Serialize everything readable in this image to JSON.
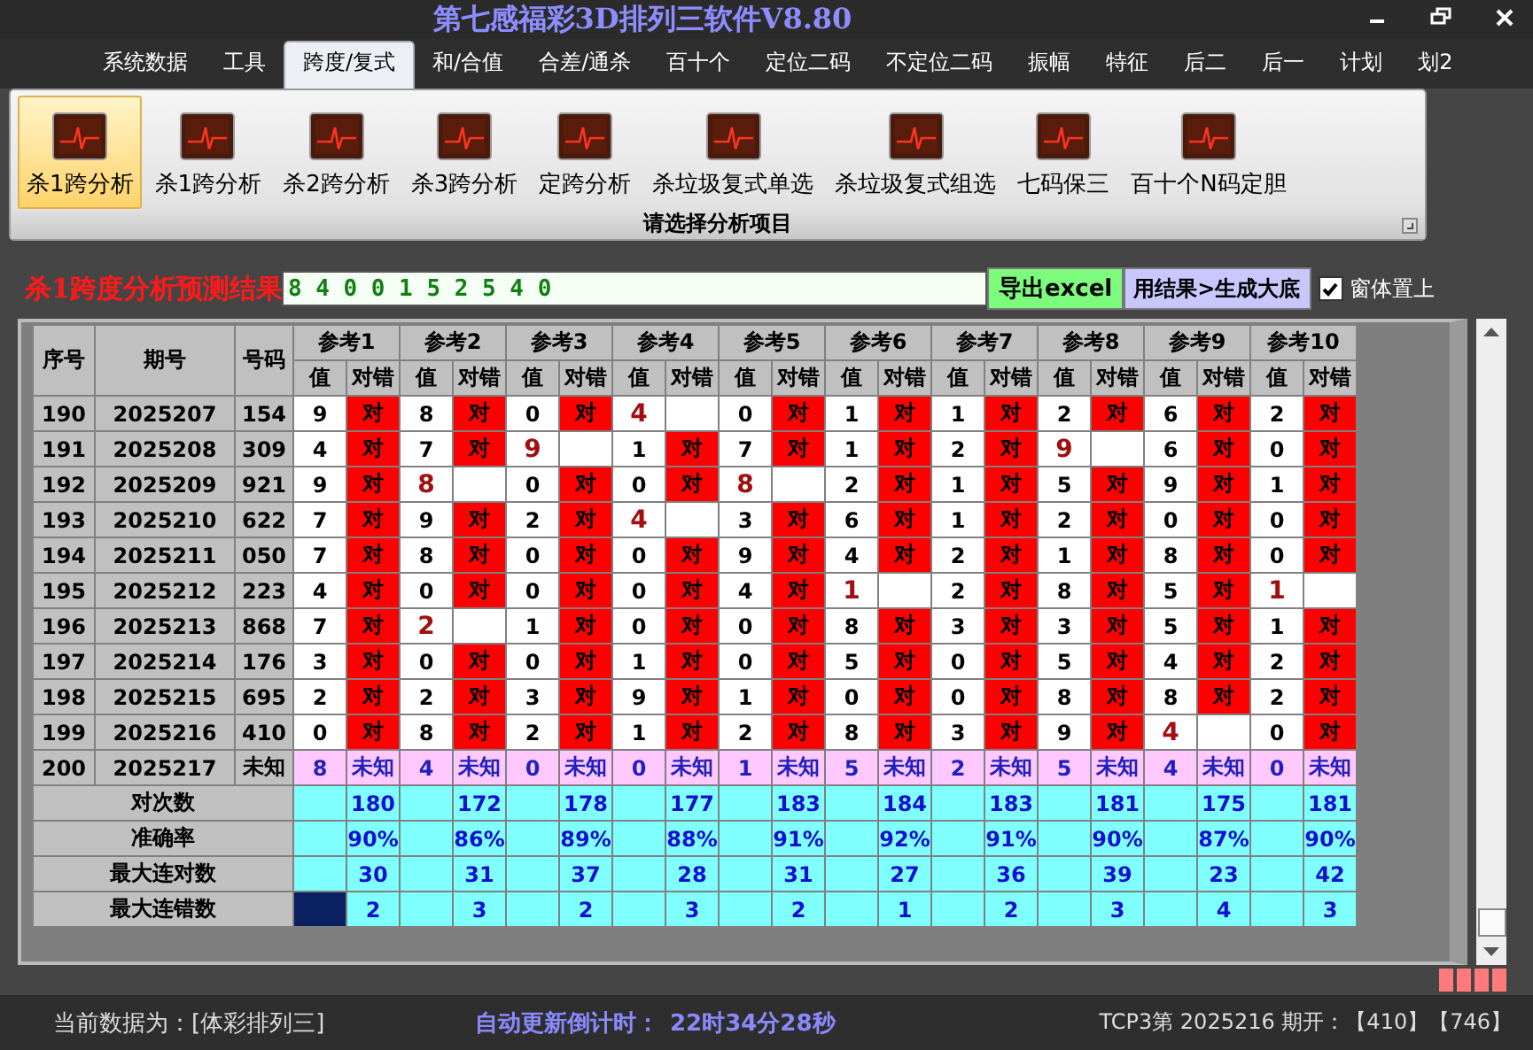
{
  "window": {
    "title": "第七感福彩3D排列三软件V8.80"
  },
  "menu": [
    {
      "label": "系统数据",
      "selected": false
    },
    {
      "label": "工具",
      "selected": false
    },
    {
      "label": "跨度/复式",
      "selected": true
    },
    {
      "label": "和/合值",
      "selected": false
    },
    {
      "label": "合差/通杀",
      "selected": false
    },
    {
      "label": "百十个",
      "selected": false
    },
    {
      "label": "定位二码",
      "selected": false
    },
    {
      "label": "不定位二码",
      "selected": false
    },
    {
      "label": "振幅",
      "selected": false
    },
    {
      "label": "特征",
      "selected": false
    },
    {
      "label": "后二",
      "selected": false
    },
    {
      "label": "后一",
      "selected": false
    },
    {
      "label": "计划",
      "selected": false
    },
    {
      "label": "划2",
      "selected": false
    }
  ],
  "ribbon": {
    "items": [
      {
        "label": "杀1跨分析",
        "selected": true
      },
      {
        "label": "杀1跨分析",
        "selected": false
      },
      {
        "label": "杀2跨分析",
        "selected": false
      },
      {
        "label": "杀3跨分析",
        "selected": false
      },
      {
        "label": "定跨分析",
        "selected": false
      },
      {
        "label": "杀垃圾复式单选",
        "selected": false
      },
      {
        "label": "杀垃圾复式组选",
        "selected": false
      },
      {
        "label": "七码保三",
        "selected": false
      },
      {
        "label": "百十个N码定胆",
        "selected": false
      }
    ],
    "group_label": "请选择分析项目"
  },
  "result": {
    "label": "杀1跨度分析预测结果",
    "value": "8 4 0 0 1 5 2 5 4 0",
    "export_button": "导出excel",
    "generate_button": "用结果>生成大底",
    "topmost": {
      "label": "窗体置上",
      "checked": true
    }
  },
  "table": {
    "columns": [
      "序号",
      "期号",
      "号码"
    ],
    "refs": [
      {
        "label": "参考1",
        "sub_columns": [
          "值",
          "对错"
        ]
      },
      {
        "label": "参考2",
        "sub_columns": [
          "值",
          "对错"
        ]
      },
      {
        "label": "参考3",
        "sub_columns": [
          "值",
          "对错"
        ]
      },
      {
        "label": "参考4",
        "sub_columns": [
          "值",
          "对错"
        ]
      },
      {
        "label": "参考5",
        "sub_columns": [
          "值",
          "对错"
        ]
      },
      {
        "label": "参考6",
        "sub_columns": [
          "值",
          "对错"
        ]
      },
      {
        "label": "参考7",
        "sub_columns": [
          "值",
          "对错"
        ]
      },
      {
        "label": "参考8",
        "sub_columns": [
          "值",
          "对错"
        ]
      },
      {
        "label": "参考9",
        "sub_columns": [
          "值",
          "对错"
        ]
      },
      {
        "label": "参考10",
        "sub_columns": [
          "值",
          "对错"
        ]
      }
    ],
    "rows": [
      {
        "kind": "history",
        "no": "190",
        "issue": "2025207",
        "code": "154",
        "cells": [
          {
            "value": "9",
            "correct": true,
            "mark": "对"
          },
          {
            "value": "8",
            "correct": true,
            "mark": "对"
          },
          {
            "value": "0",
            "correct": true,
            "mark": "对"
          },
          {
            "value": "4",
            "correct": false
          },
          {
            "value": "0",
            "correct": true,
            "mark": "对"
          },
          {
            "value": "1",
            "correct": true,
            "mark": "对"
          },
          {
            "value": "1",
            "correct": true,
            "mark": "对"
          },
          {
            "value": "2",
            "correct": true,
            "mark": "对"
          },
          {
            "value": "6",
            "correct": true,
            "mark": "对"
          },
          {
            "value": "2",
            "correct": true,
            "mark": "对"
          }
        ]
      },
      {
        "kind": "history",
        "no": "191",
        "issue": "2025208",
        "code": "309",
        "cells": [
          {
            "value": "4",
            "correct": true,
            "mark": "对"
          },
          {
            "value": "7",
            "correct": true,
            "mark": "对"
          },
          {
            "value": "9",
            "correct": false
          },
          {
            "value": "1",
            "correct": true,
            "mark": "对"
          },
          {
            "value": "7",
            "correct": true,
            "mark": "对"
          },
          {
            "value": "1",
            "correct": true,
            "mark": "对"
          },
          {
            "value": "2",
            "correct": true,
            "mark": "对"
          },
          {
            "value": "9",
            "correct": false
          },
          {
            "value": "6",
            "correct": true,
            "mark": "对"
          },
          {
            "value": "0",
            "correct": true,
            "mark": "对"
          }
        ]
      },
      {
        "kind": "history",
        "no": "192",
        "issue": "2025209",
        "code": "921",
        "cells": [
          {
            "value": "9",
            "correct": true,
            "mark": "对"
          },
          {
            "value": "8",
            "correct": false
          },
          {
            "value": "0",
            "correct": true,
            "mark": "对"
          },
          {
            "value": "0",
            "correct": true,
            "mark": "对"
          },
          {
            "value": "8",
            "correct": false
          },
          {
            "value": "2",
            "correct": true,
            "mark": "对"
          },
          {
            "value": "1",
            "correct": true,
            "mark": "对"
          },
          {
            "value": "5",
            "correct": true,
            "mark": "对"
          },
          {
            "value": "9",
            "correct": true,
            "mark": "对"
          },
          {
            "value": "1",
            "correct": true,
            "mark": "对"
          }
        ]
      },
      {
        "kind": "history",
        "no": "193",
        "issue": "2025210",
        "code": "622",
        "cells": [
          {
            "value": "7",
            "correct": true,
            "mark": "对"
          },
          {
            "value": "9",
            "correct": true,
            "mark": "对"
          },
          {
            "value": "2",
            "correct": true,
            "mark": "对"
          },
          {
            "value": "4",
            "correct": false
          },
          {
            "value": "3",
            "correct": true,
            "mark": "对"
          },
          {
            "value": "6",
            "correct": true,
            "mark": "对"
          },
          {
            "value": "1",
            "correct": true,
            "mark": "对"
          },
          {
            "value": "2",
            "correct": true,
            "mark": "对"
          },
          {
            "value": "0",
            "correct": true,
            "mark": "对"
          },
          {
            "value": "0",
            "correct": true,
            "mark": "对"
          }
        ]
      },
      {
        "kind": "history",
        "no": "194",
        "issue": "2025211",
        "code": "050",
        "cells": [
          {
            "value": "7",
            "correct": true,
            "mark": "对"
          },
          {
            "value": "8",
            "correct": true,
            "mark": "对"
          },
          {
            "value": "0",
            "correct": true,
            "mark": "对"
          },
          {
            "value": "0",
            "correct": true,
            "mark": "对"
          },
          {
            "value": "9",
            "correct": true,
            "mark": "对"
          },
          {
            "value": "4",
            "correct": true,
            "mark": "对"
          },
          {
            "value": "2",
            "correct": true,
            "mark": "对"
          },
          {
            "value": "1",
            "correct": true,
            "mark": "对"
          },
          {
            "value": "8",
            "correct": true,
            "mark": "对"
          },
          {
            "value": "0",
            "correct": true,
            "mark": "对"
          }
        ]
      },
      {
        "kind": "history",
        "no": "195",
        "issue": "2025212",
        "code": "223",
        "cells": [
          {
            "value": "4",
            "correct": true,
            "mark": "对"
          },
          {
            "value": "0",
            "correct": true,
            "mark": "对"
          },
          {
            "value": "0",
            "correct": true,
            "mark": "对"
          },
          {
            "value": "0",
            "correct": true,
            "mark": "对"
          },
          {
            "value": "4",
            "correct": true,
            "mark": "对"
          },
          {
            "value": "1",
            "correct": false
          },
          {
            "value": "2",
            "correct": true,
            "mark": "对"
          },
          {
            "value": "8",
            "correct": true,
            "mark": "对"
          },
          {
            "value": "5",
            "correct": true,
            "mark": "对"
          },
          {
            "value": "1",
            "correct": false
          }
        ]
      },
      {
        "kind": "history",
        "no": "196",
        "issue": "2025213",
        "code": "868",
        "cells": [
          {
            "value": "7",
            "correct": true,
            "mark": "对"
          },
          {
            "value": "2",
            "correct": false
          },
          {
            "value": "1",
            "correct": true,
            "mark": "对"
          },
          {
            "value": "0",
            "correct": true,
            "mark": "对"
          },
          {
            "value": "0",
            "correct": true,
            "mark": "对"
          },
          {
            "value": "8",
            "correct": true,
            "mark": "对"
          },
          {
            "value": "3",
            "correct": true,
            "mark": "对"
          },
          {
            "value": "3",
            "correct": true,
            "mark": "对"
          },
          {
            "value": "5",
            "correct": true,
            "mark": "对"
          },
          {
            "value": "1",
            "correct": true,
            "mark": "对"
          }
        ]
      },
      {
        "kind": "history",
        "no": "197",
        "issue": "2025214",
        "code": "176",
        "cells": [
          {
            "value": "3",
            "correct": true,
            "mark": "对"
          },
          {
            "value": "0",
            "correct": true,
            "mark": "对"
          },
          {
            "value": "0",
            "correct": true,
            "mark": "对"
          },
          {
            "value": "1",
            "correct": true,
            "mark": "对"
          },
          {
            "value": "0",
            "correct": true,
            "mark": "对"
          },
          {
            "value": "5",
            "correct": true,
            "mark": "对"
          },
          {
            "value": "0",
            "correct": true,
            "mark": "对"
          },
          {
            "value": "5",
            "correct": true,
            "mark": "对"
          },
          {
            "value": "4",
            "correct": true,
            "mark": "对"
          },
          {
            "value": "2",
            "correct": true,
            "mark": "对"
          }
        ]
      },
      {
        "kind": "history",
        "no": "198",
        "issue": "2025215",
        "code": "695",
        "cells": [
          {
            "value": "2",
            "correct": true,
            "mark": "对"
          },
          {
            "value": "2",
            "correct": true,
            "mark": "对"
          },
          {
            "value": "3",
            "correct": true,
            "mark": "对"
          },
          {
            "value": "9",
            "correct": true,
            "mark": "对"
          },
          {
            "value": "1",
            "correct": true,
            "mark": "对"
          },
          {
            "value": "0",
            "correct": true,
            "mark": "对"
          },
          {
            "value": "0",
            "correct": true,
            "mark": "对"
          },
          {
            "value": "8",
            "correct": true,
            "mark": "对"
          },
          {
            "value": "8",
            "correct": true,
            "mark": "对"
          },
          {
            "value": "2",
            "correct": true,
            "mark": "对"
          }
        ]
      },
      {
        "kind": "history",
        "no": "199",
        "issue": "2025216",
        "code": "410",
        "cells": [
          {
            "value": "0",
            "correct": true,
            "mark": "对"
          },
          {
            "value": "8",
            "correct": true,
            "mark": "对"
          },
          {
            "value": "2",
            "correct": true,
            "mark": "对"
          },
          {
            "value": "1",
            "correct": true,
            "mark": "对"
          },
          {
            "value": "2",
            "correct": true,
            "mark": "对"
          },
          {
            "value": "8",
            "correct": true,
            "mark": "对"
          },
          {
            "value": "3",
            "correct": true,
            "mark": "对"
          },
          {
            "value": "9",
            "correct": true,
            "mark": "对"
          },
          {
            "value": "4",
            "correct": false
          },
          {
            "value": "0",
            "correct": true,
            "mark": "对"
          }
        ]
      },
      {
        "kind": "pending",
        "no": "200",
        "issue": "2025217",
        "code": "未知",
        "cells": [
          {
            "value": "8",
            "mark": "未知"
          },
          {
            "value": "4",
            "mark": "未知"
          },
          {
            "value": "0",
            "mark": "未知"
          },
          {
            "value": "0",
            "mark": "未知"
          },
          {
            "value": "1",
            "mark": "未知"
          },
          {
            "value": "5",
            "mark": "未知"
          },
          {
            "value": "2",
            "mark": "未知"
          },
          {
            "value": "5",
            "mark": "未知"
          },
          {
            "value": "4",
            "mark": "未知"
          },
          {
            "value": "0",
            "mark": "未知"
          }
        ]
      }
    ],
    "stats": [
      {
        "label": "对次数",
        "selected": false,
        "values": [
          "180",
          "172",
          "178",
          "177",
          "183",
          "184",
          "183",
          "181",
          "175",
          "181"
        ]
      },
      {
        "label": "准确率",
        "selected": false,
        "values": [
          "90%",
          "86%",
          "89%",
          "88%",
          "91%",
          "92%",
          "91%",
          "90%",
          "87%",
          "90%"
        ]
      },
      {
        "label": "最大连对数",
        "selected": false,
        "values": [
          "30",
          "31",
          "37",
          "28",
          "31",
          "27",
          "36",
          "39",
          "23",
          "42"
        ]
      },
      {
        "label": "最大连错数",
        "selected": true,
        "values": [
          "2",
          "3",
          "2",
          "3",
          "2",
          "1",
          "2",
          "3",
          "4",
          "3"
        ]
      }
    ]
  },
  "status_bar": {
    "data_label": "当前数据为：[体彩排列三]",
    "countdown_label": "自动更新倒计时：",
    "countdown": "22时34分28秒",
    "latest": "TCP3第 2025216 期开：【410】【746】"
  }
}
